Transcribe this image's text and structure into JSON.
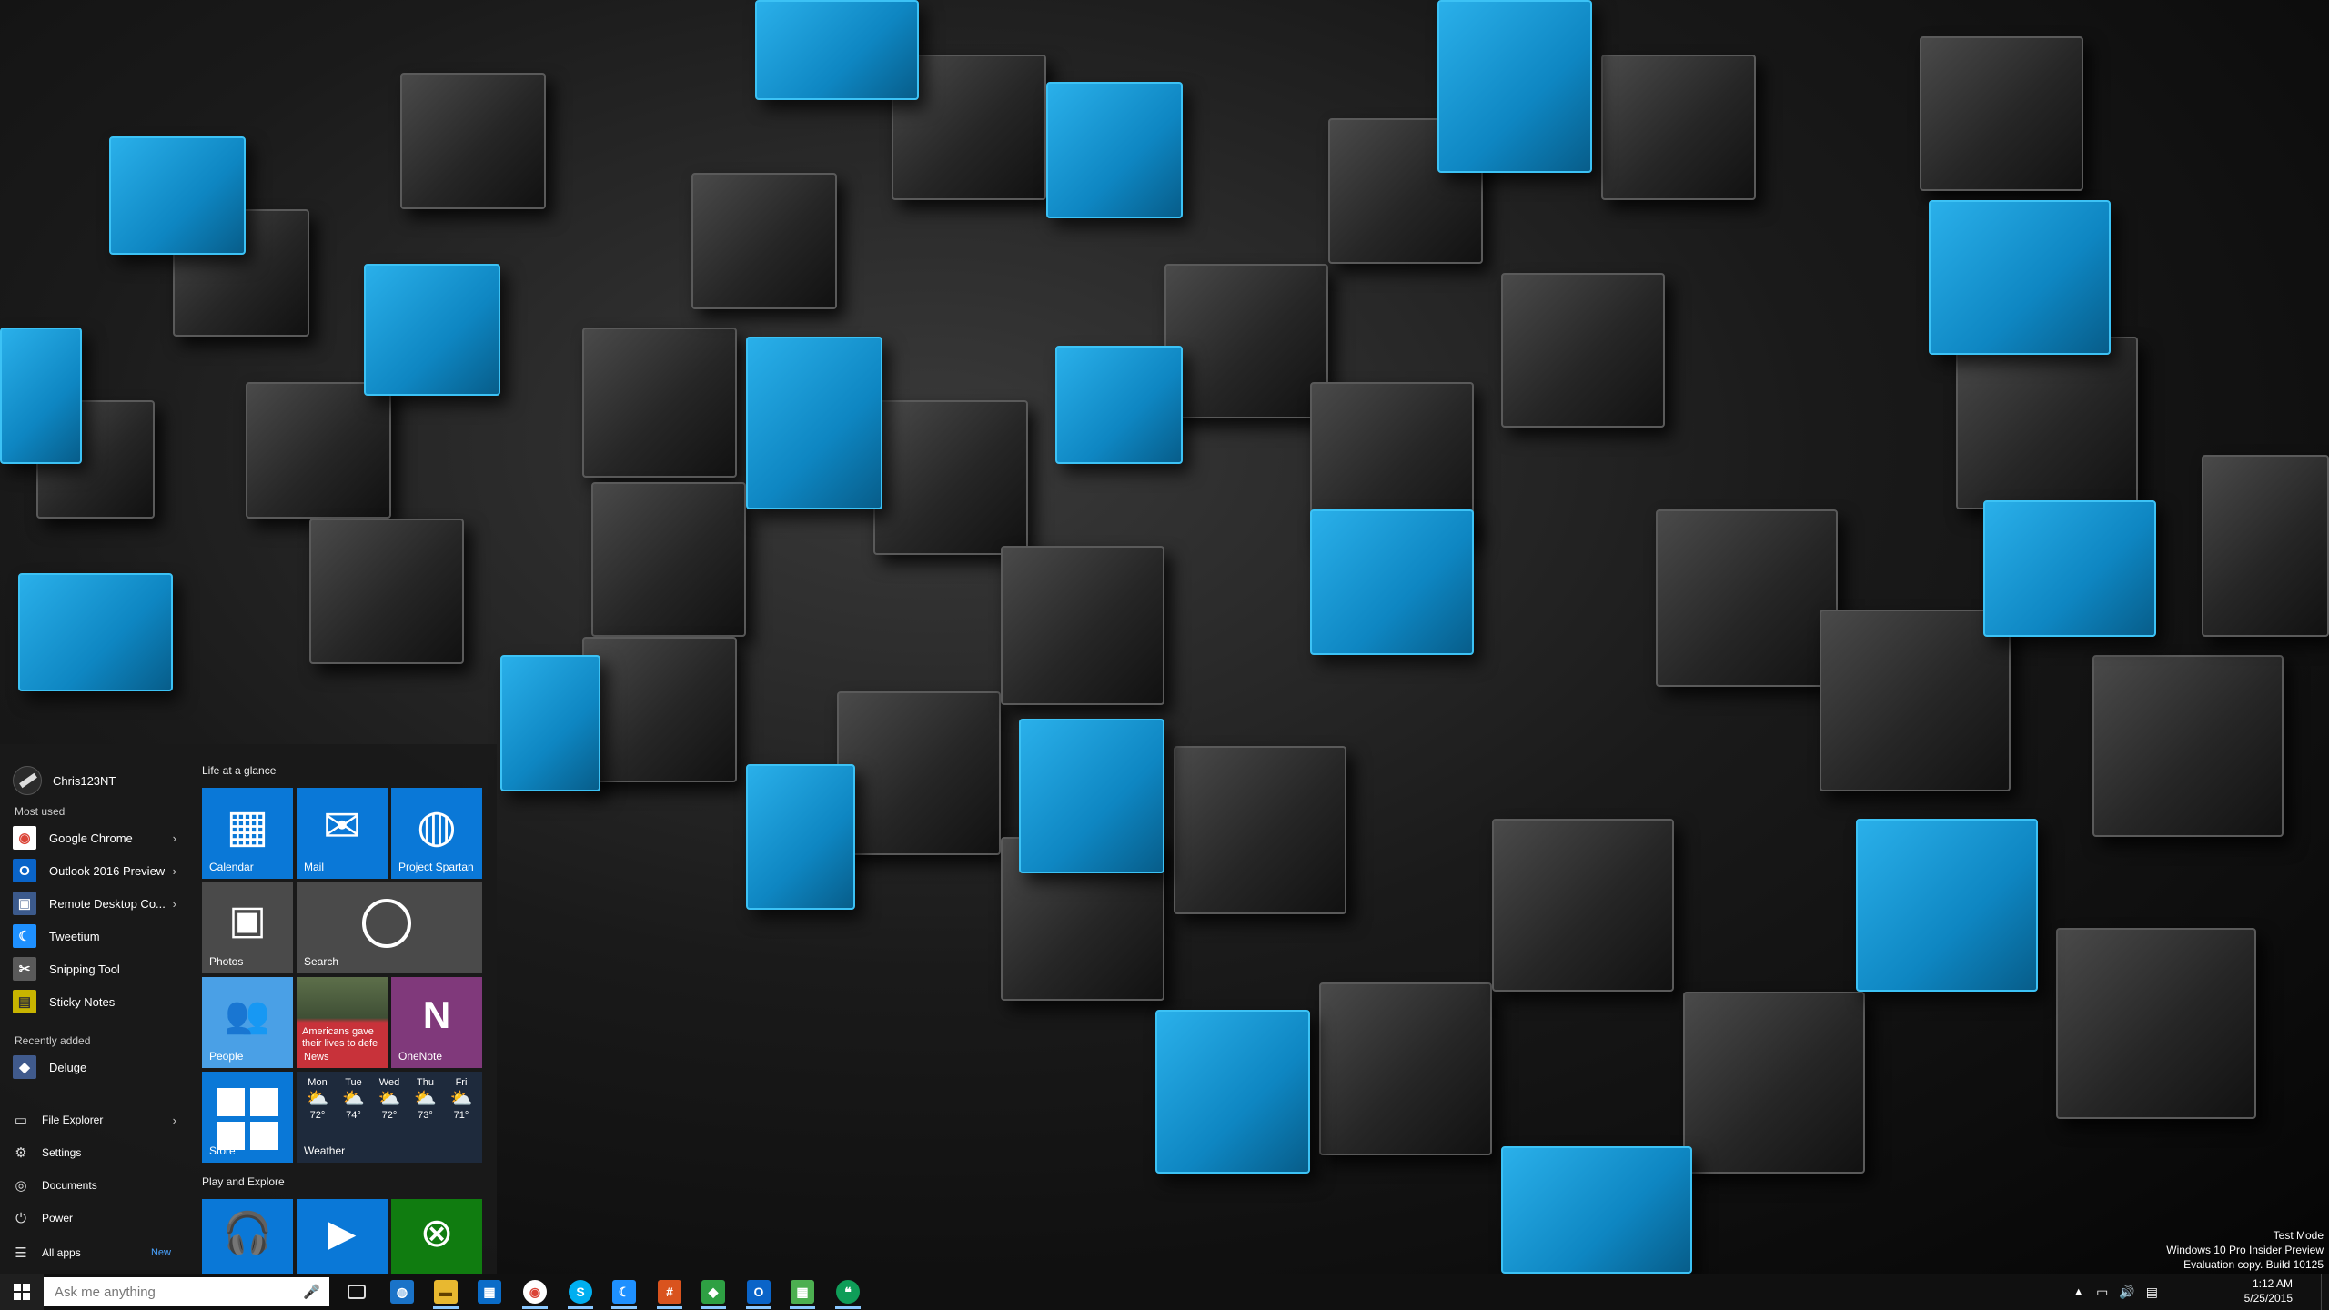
{
  "start_menu": {
    "user_name": "Chris123NT",
    "most_used_label": "Most used",
    "most_used": [
      {
        "label": "Google Chrome",
        "icon": "chrome-icon",
        "glyph": "◉",
        "color": "#db4437",
        "has_submenu": true
      },
      {
        "label": "Outlook 2016 Preview",
        "icon": "outlook-icon",
        "glyph": "O",
        "color": "#0a64c8",
        "has_submenu": true
      },
      {
        "label": "Remote Desktop Co...",
        "icon": "remote-desktop-icon",
        "glyph": "▣",
        "color": "#3c5a8c",
        "has_submenu": true
      },
      {
        "label": "Tweetium",
        "icon": "tweetium-icon",
        "glyph": "☾",
        "color": "#1e90ff",
        "has_submenu": false
      },
      {
        "label": "Snipping Tool",
        "icon": "snipping-tool-icon",
        "glyph": "✂",
        "color": "#5a5a5a",
        "has_submenu": false
      },
      {
        "label": "Sticky Notes",
        "icon": "sticky-notes-icon",
        "glyph": "▤",
        "color": "#c8b400",
        "has_submenu": false
      }
    ],
    "recently_added_label": "Recently added",
    "recently_added": [
      {
        "label": "Deluge",
        "icon": "deluge-icon",
        "glyph": "◆",
        "color": "#405a8c"
      }
    ],
    "system": [
      {
        "label": "File Explorer",
        "icon": "file-explorer-icon",
        "glyph": "▭",
        "has_submenu": true
      },
      {
        "label": "Settings",
        "icon": "gear-icon",
        "glyph": "⚙",
        "has_submenu": false
      },
      {
        "label": "Documents",
        "icon": "documents-icon",
        "glyph": "◎",
        "has_submenu": false
      },
      {
        "label": "Power",
        "icon": "power-icon",
        "glyph": "⏻",
        "has_submenu": false
      },
      {
        "label": "All apps",
        "icon": "all-apps-icon",
        "glyph": "☰",
        "has_submenu": false
      }
    ],
    "all_apps_badge": "New",
    "groups": [
      "Life at a glance",
      "Play and Explore"
    ],
    "tiles": {
      "calendar": "Calendar",
      "mail": "Mail",
      "project_spartan": "Project Spartan",
      "photos": "Photos",
      "search": "Search",
      "people": "People",
      "news": "News",
      "news_headline": "Americans gave their lives to defe",
      "onenote": "OneNote",
      "store": "Store",
      "weather": "Weather"
    },
    "weather_days": [
      {
        "day": "Mon",
        "temp": "72°"
      },
      {
        "day": "Tue",
        "temp": "74°"
      },
      {
        "day": "Wed",
        "temp": "72°"
      },
      {
        "day": "Thu",
        "temp": "73°"
      },
      {
        "day": "Fri",
        "temp": "71°"
      }
    ]
  },
  "taskbar": {
    "search_placeholder": "Ask me anything",
    "pinned": [
      {
        "name": "task-view-icon",
        "glyph": "▭",
        "color": "#101010"
      },
      {
        "name": "edge-icon",
        "glyph": "◍",
        "color": "#1a73c8"
      },
      {
        "name": "file-explorer-icon",
        "glyph": "▬",
        "color": "#e8b830"
      },
      {
        "name": "store-icon",
        "glyph": "▦",
        "color": "#0a6cc8"
      },
      {
        "name": "chrome-icon",
        "glyph": "◉",
        "color": "#db4437"
      },
      {
        "name": "skype-icon",
        "glyph": "S",
        "color": "#00aff0"
      },
      {
        "name": "tweetium-icon",
        "glyph": "☾",
        "color": "#1e90ff"
      },
      {
        "name": "hashtag-app-icon",
        "glyph": "#",
        "color": "#d9531e"
      },
      {
        "name": "green-app-icon",
        "glyph": "◆",
        "color": "#2ea043"
      },
      {
        "name": "outlook-icon",
        "glyph": "O",
        "color": "#0a64c8"
      },
      {
        "name": "grid-app-icon",
        "glyph": "▦",
        "color": "#4caf50"
      },
      {
        "name": "hangouts-icon",
        "glyph": "❝",
        "color": "#0f9d58"
      }
    ],
    "clock_time": "1:12 AM",
    "clock_date": "5/25/2015"
  },
  "watermark": {
    "line1": "Test Mode",
    "line2": "Windows 10 Pro Insider Preview",
    "line3": "Evaluation copy. Build 10125"
  }
}
